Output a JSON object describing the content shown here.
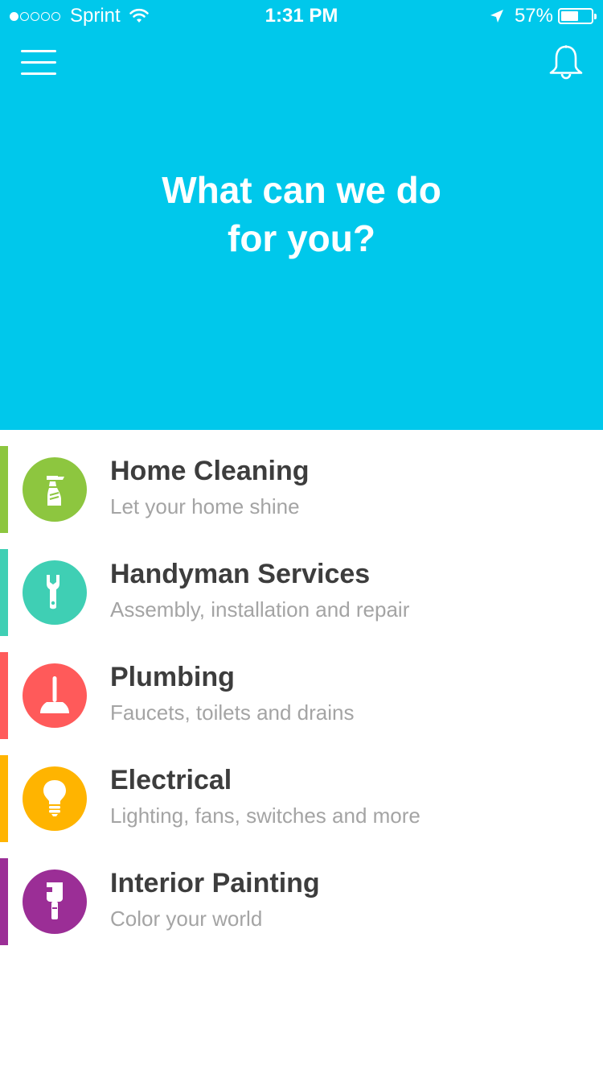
{
  "status_bar": {
    "carrier": "Sprint",
    "signal_bars_filled": 1,
    "signal_bars_total": 5,
    "time": "1:31 PM",
    "battery_percent_label": "57%",
    "battery_level": 0.57,
    "icons": [
      "signal-dots-icon",
      "wifi-icon",
      "location-arrow-icon",
      "battery-icon"
    ]
  },
  "header": {
    "menu_icon": "hamburger-menu-icon",
    "notification_icon": "bell-icon",
    "title_line1": "What can we do",
    "title_line2": "for you?",
    "background_color": "#00c8eb"
  },
  "services": [
    {
      "title": "Home Cleaning",
      "subtitle": "Let your home shine",
      "color": "#8dc63f",
      "icon": "spray-bottle-icon"
    },
    {
      "title": "Handyman Services",
      "subtitle": "Assembly, installation and repair",
      "color": "#3fcfb4",
      "icon": "wrench-icon"
    },
    {
      "title": "Plumbing",
      "subtitle": "Faucets, toilets and drains",
      "color": "#ff5a5a",
      "icon": "plunger-icon"
    },
    {
      "title": "Electrical",
      "subtitle": "Lighting, fans, switches and more",
      "color": "#ffb400",
      "icon": "lightbulb-icon"
    },
    {
      "title": "Interior Painting",
      "subtitle": "Color your world",
      "color": "#9b2e96",
      "icon": "paintbrush-icon"
    }
  ]
}
